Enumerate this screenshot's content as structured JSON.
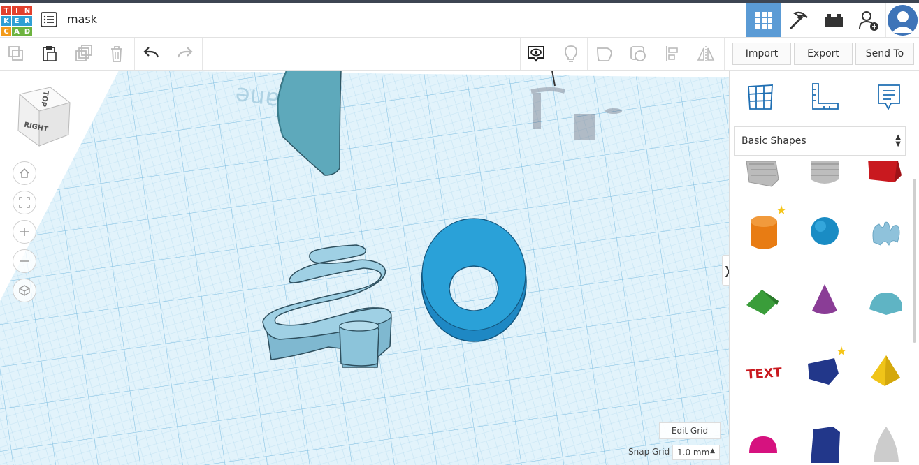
{
  "app": {
    "logo_letters": [
      "T",
      "I",
      "N",
      "K",
      "E",
      "R",
      "C",
      "A",
      "D"
    ],
    "logo_colors": [
      "#e2402d",
      "#e2402d",
      "#e2402d",
      "#2f9fd4",
      "#2f9fd4",
      "#2f9fd4",
      "#f29a1a",
      "#6db33f",
      "#6db33f"
    ],
    "design_title": "mask"
  },
  "topbar_right": {
    "items": [
      "grid-view-icon",
      "pickaxe-icon",
      "bricks-icon",
      "add-user-icon",
      "avatar"
    ]
  },
  "toolbar": {
    "import_label": "Import",
    "export_label": "Export",
    "sendto_label": "Send To"
  },
  "viewcube": {
    "top_label": "TOP",
    "right_label": "RIGHT"
  },
  "workplane": {
    "watermark": "plane"
  },
  "grid": {
    "edit_label": "Edit Grid",
    "snap_label": "Snap Grid",
    "snap_value": "1.0 mm"
  },
  "panel": {
    "category": "Basic Shapes",
    "shapes": [
      "box-hole",
      "cylinder-hole",
      "box",
      "cylinder",
      "sphere",
      "scribble",
      "roof",
      "cone",
      "round-roof",
      "text",
      "wedge",
      "pyramid",
      "half-sphere",
      "polygon",
      "paraboloid"
    ],
    "colors": {
      "accent": "#5b9bd5",
      "grid": "#cfe9f5"
    }
  }
}
